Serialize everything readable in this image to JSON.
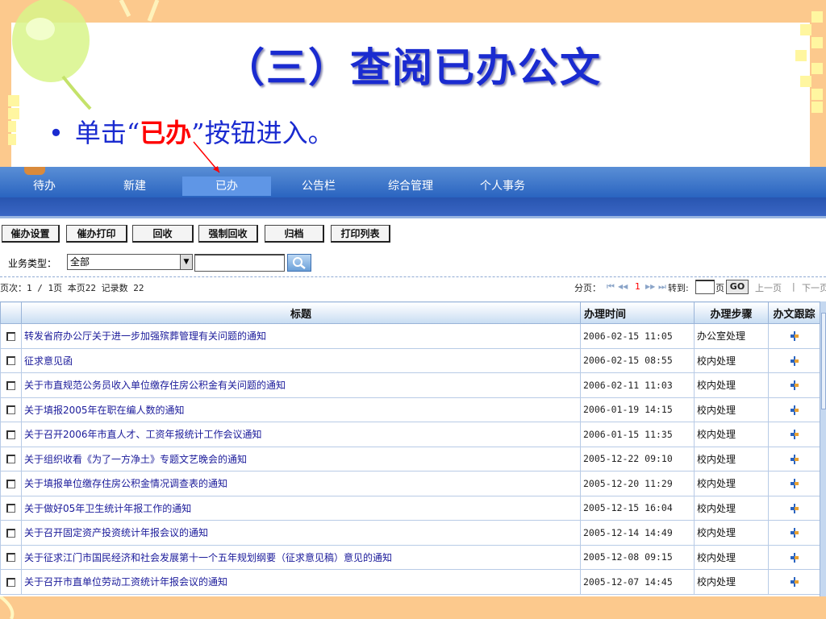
{
  "slide": {
    "title": "（三）查阅已办公文",
    "bullet_dot": "•",
    "bullet_prefix": "单击“",
    "bullet_keyword": "已办",
    "bullet_suffix": "”按钮进入。"
  },
  "nav": {
    "tabs": [
      {
        "label": "待办"
      },
      {
        "label": "新建"
      },
      {
        "label": "已办"
      },
      {
        "label": "公告栏"
      },
      {
        "label": "综合管理"
      },
      {
        "label": "个人事务"
      }
    ],
    "active_tab": "已办"
  },
  "toolbar": {
    "buttons": [
      {
        "label": "催办设置"
      },
      {
        "label": "催办打印"
      },
      {
        "label": "回收"
      },
      {
        "label": "强制回收"
      },
      {
        "label": "归档"
      },
      {
        "label": "打印列表"
      }
    ]
  },
  "filter": {
    "label": "业务类型：",
    "selected": "全部",
    "search_value": ""
  },
  "pager": {
    "summary": "页次：1 / 1页 本页22 记录数 22",
    "label": "分页：",
    "nav_first": "⏮",
    "nav_prev": "◀◀",
    "current_page": "1",
    "nav_next": "▶▶",
    "nav_last": "⏭",
    "goto_label": "转到:",
    "page_unit": "页",
    "go_label": "GO",
    "prev_link": "上一页",
    "separator": "|",
    "next_link": "下一页"
  },
  "table": {
    "columns": [
      "",
      "标题",
      "办理时间",
      "办理步骤",
      "办文跟踪"
    ],
    "rows": [
      {
        "title": "转发省府办公厅关于进一步加强殡葬管理有关问题的通知",
        "time": "2006-02-15 11:05",
        "step": "办公室处理"
      },
      {
        "title": "征求意见函",
        "time": "2006-02-15 08:55",
        "step": "校内处理"
      },
      {
        "title": "关于市直规范公务员收入单位缴存住房公积金有关问题的通知",
        "time": "2006-02-11 11:03",
        "step": "校内处理"
      },
      {
        "title": "关于填报2005年在职在编人数的通知",
        "time": "2006-01-19 14:15",
        "step": "校内处理"
      },
      {
        "title": "关于召开2006年市直人才、工资年报统计工作会议通知",
        "time": "2006-01-15 11:35",
        "step": "校内处理"
      },
      {
        "title": "关于组织收看《为了一方净土》专题文艺晚会的通知",
        "time": "2005-12-22 09:10",
        "step": "校内处理"
      },
      {
        "title": "关于填报单位缴存住房公积金情况调查表的通知",
        "time": "2005-12-20 11:29",
        "step": "校内处理"
      },
      {
        "title": "关于做好05年卫生统计年报工作的通知",
        "time": "2005-12-15 16:04",
        "step": "校内处理"
      },
      {
        "title": "关于召开固定资产投资统计年报会议的通知",
        "time": "2005-12-14 14:49",
        "step": "校内处理"
      },
      {
        "title": "关于征求江门市国民经济和社会发展第十一个五年规划纲要（征求意见稿）意见的通知",
        "time": "2005-12-08 09:15",
        "step": "校内处理"
      },
      {
        "title": "关于召开市直单位劳动工资统计年报会议的通知",
        "time": "2005-12-07 14:45",
        "step": "校内处理"
      }
    ]
  },
  "colors": {
    "slide_bg": "#fcc98d",
    "title_blue": "#1a2bd0",
    "keyword_red": "#ff0000",
    "nav_blue": "#2a64c0"
  },
  "icons": {
    "trace": "trace-icon",
    "search": "search-icon",
    "dropdown": "chevron-down-icon"
  }
}
